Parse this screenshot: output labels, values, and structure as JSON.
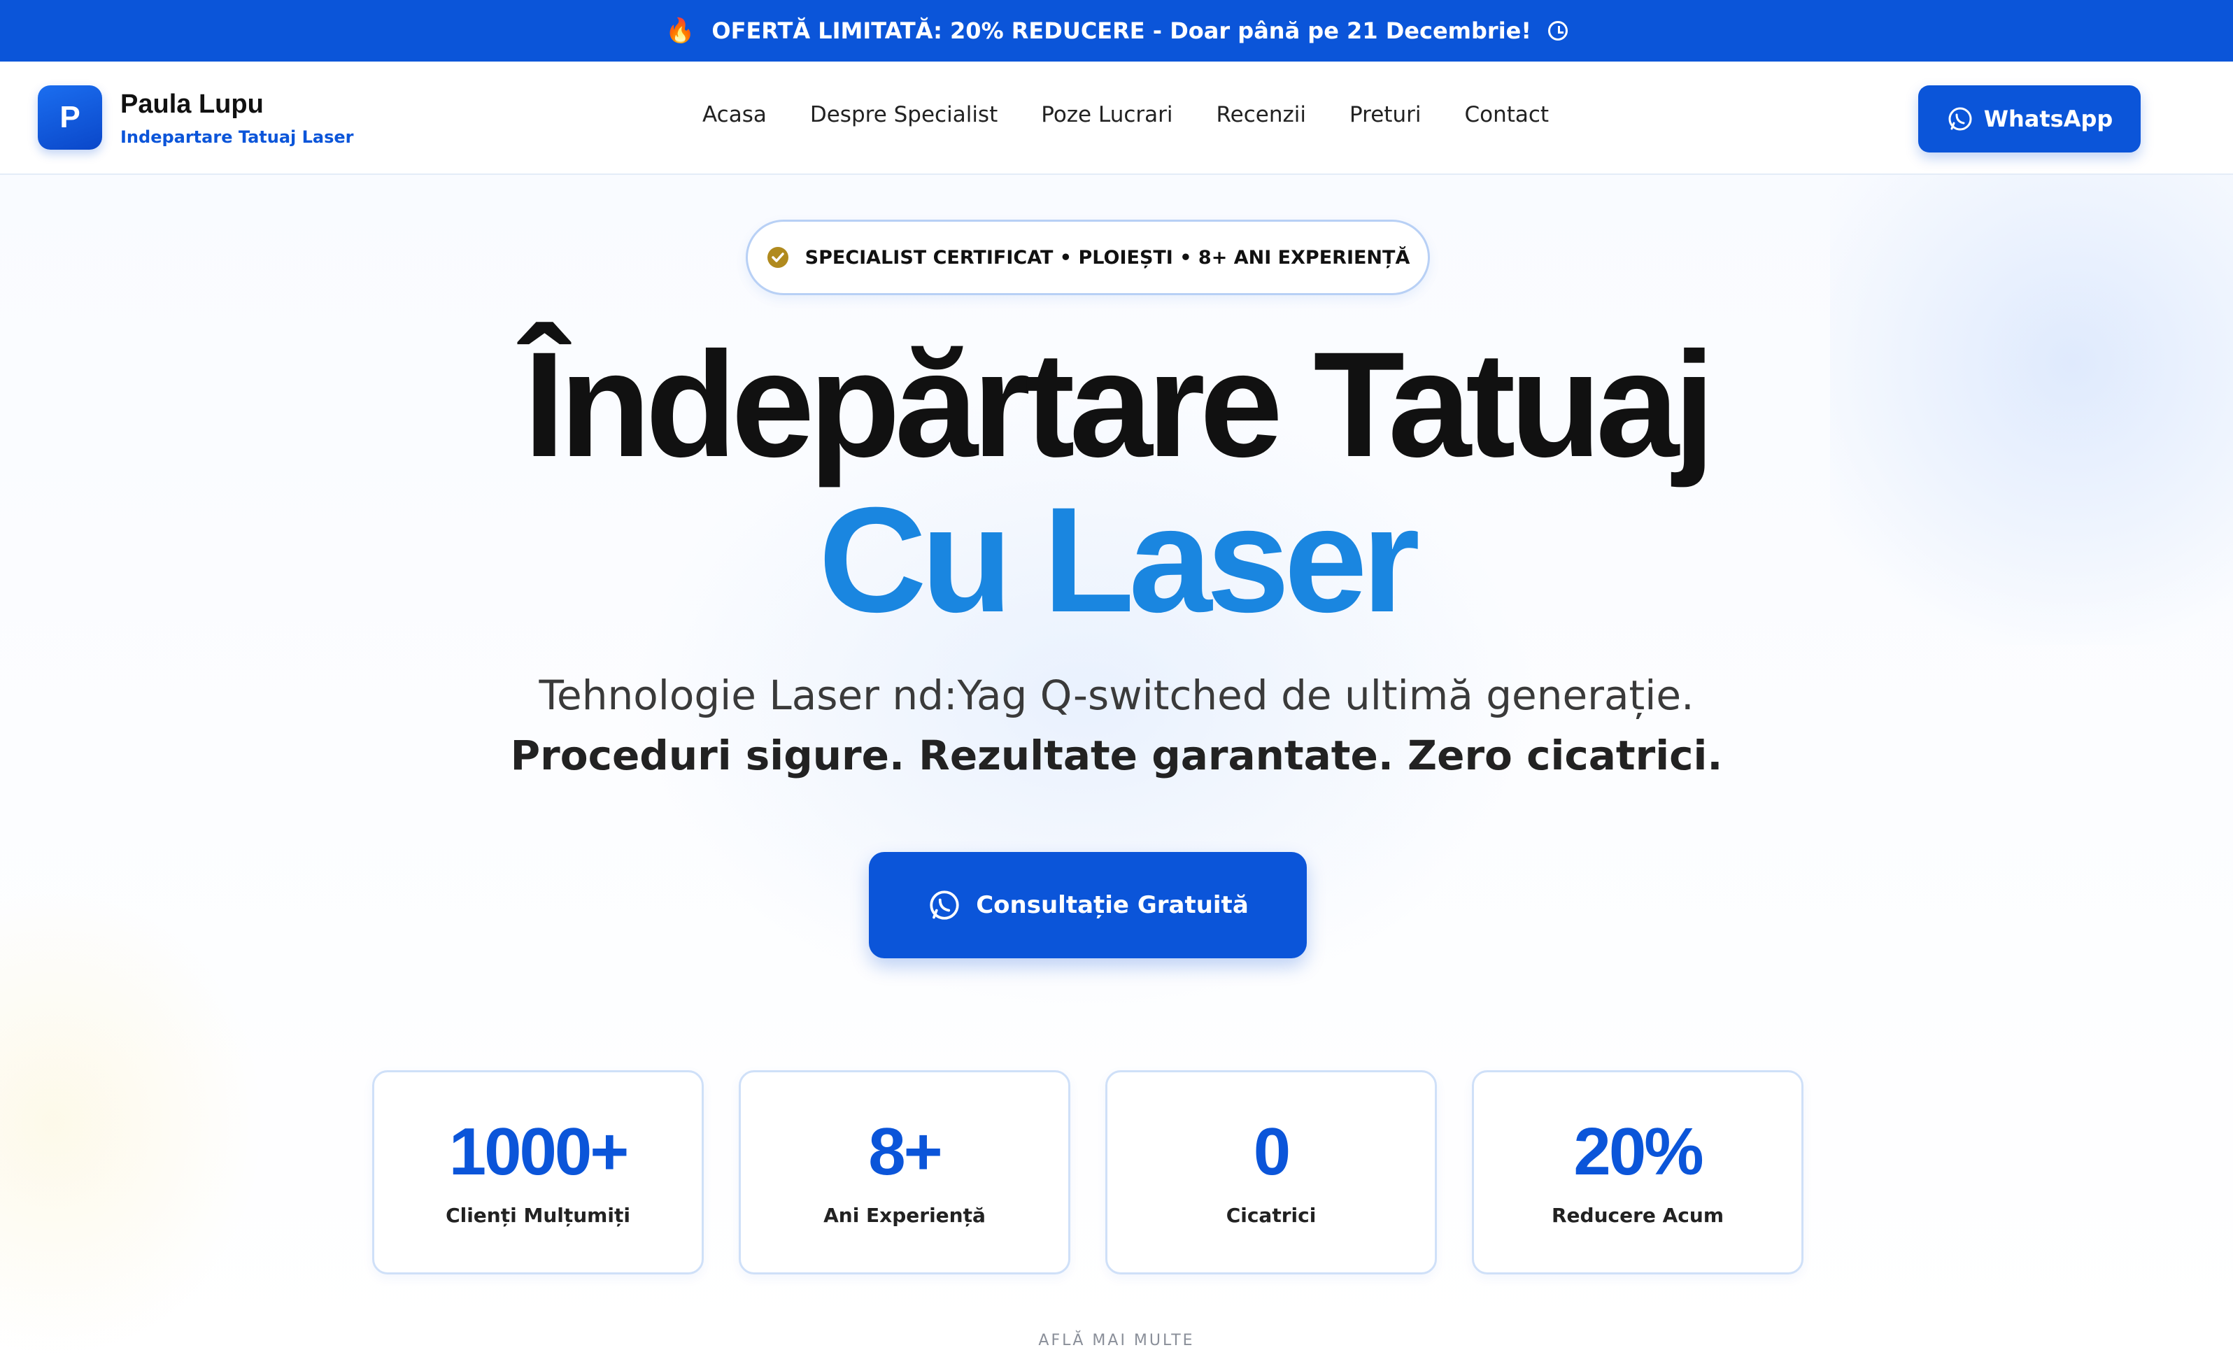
{
  "promo": {
    "icon": "flame-icon",
    "text": "OFERTĂ LIMITATĂ: 20% REDUCERE - Doar până pe 21 Decembrie!",
    "trailing_icon": "clock-icon"
  },
  "header": {
    "logo_letter": "P",
    "brand_name": "Paula Lupu",
    "brand_subtitle": "Indepartare Tatuaj Laser",
    "nav": [
      "Acasa",
      "Despre Specialist",
      "Poze Lucrari",
      "Recenzii",
      "Preturi",
      "Contact"
    ],
    "cta_label": "WhatsApp"
  },
  "hero": {
    "badge": "SPECIALIST CERTIFICAT • PLOIEȘTI • 8+ ANI EXPERIENȚĂ",
    "title_line1": "Îndepărtare Tatuaj",
    "title_line2": "Cu Laser",
    "subtitle_line1": "Tehnologie Laser nd:Yag Q-switched de ultimă generație.",
    "subtitle_line2": "Proceduri sigure. Rezultate garantate. Zero cicatrici.",
    "cta_label": "Consultație Gratuită",
    "learn_more": "AFLĂ MAI MULTE"
  },
  "stats": [
    {
      "value": "1000+",
      "label": "Clienți Mulțumiți"
    },
    {
      "value": "8+",
      "label": "Ani Experiență"
    },
    {
      "value": "0",
      "label": "Cicatrici"
    },
    {
      "value": "20%",
      "label": "Reducere Acum"
    }
  ],
  "colors": {
    "brand_blue": "#0b55d9",
    "accent_blue": "#1a86e0",
    "badge_gold": "#b08a1e"
  }
}
